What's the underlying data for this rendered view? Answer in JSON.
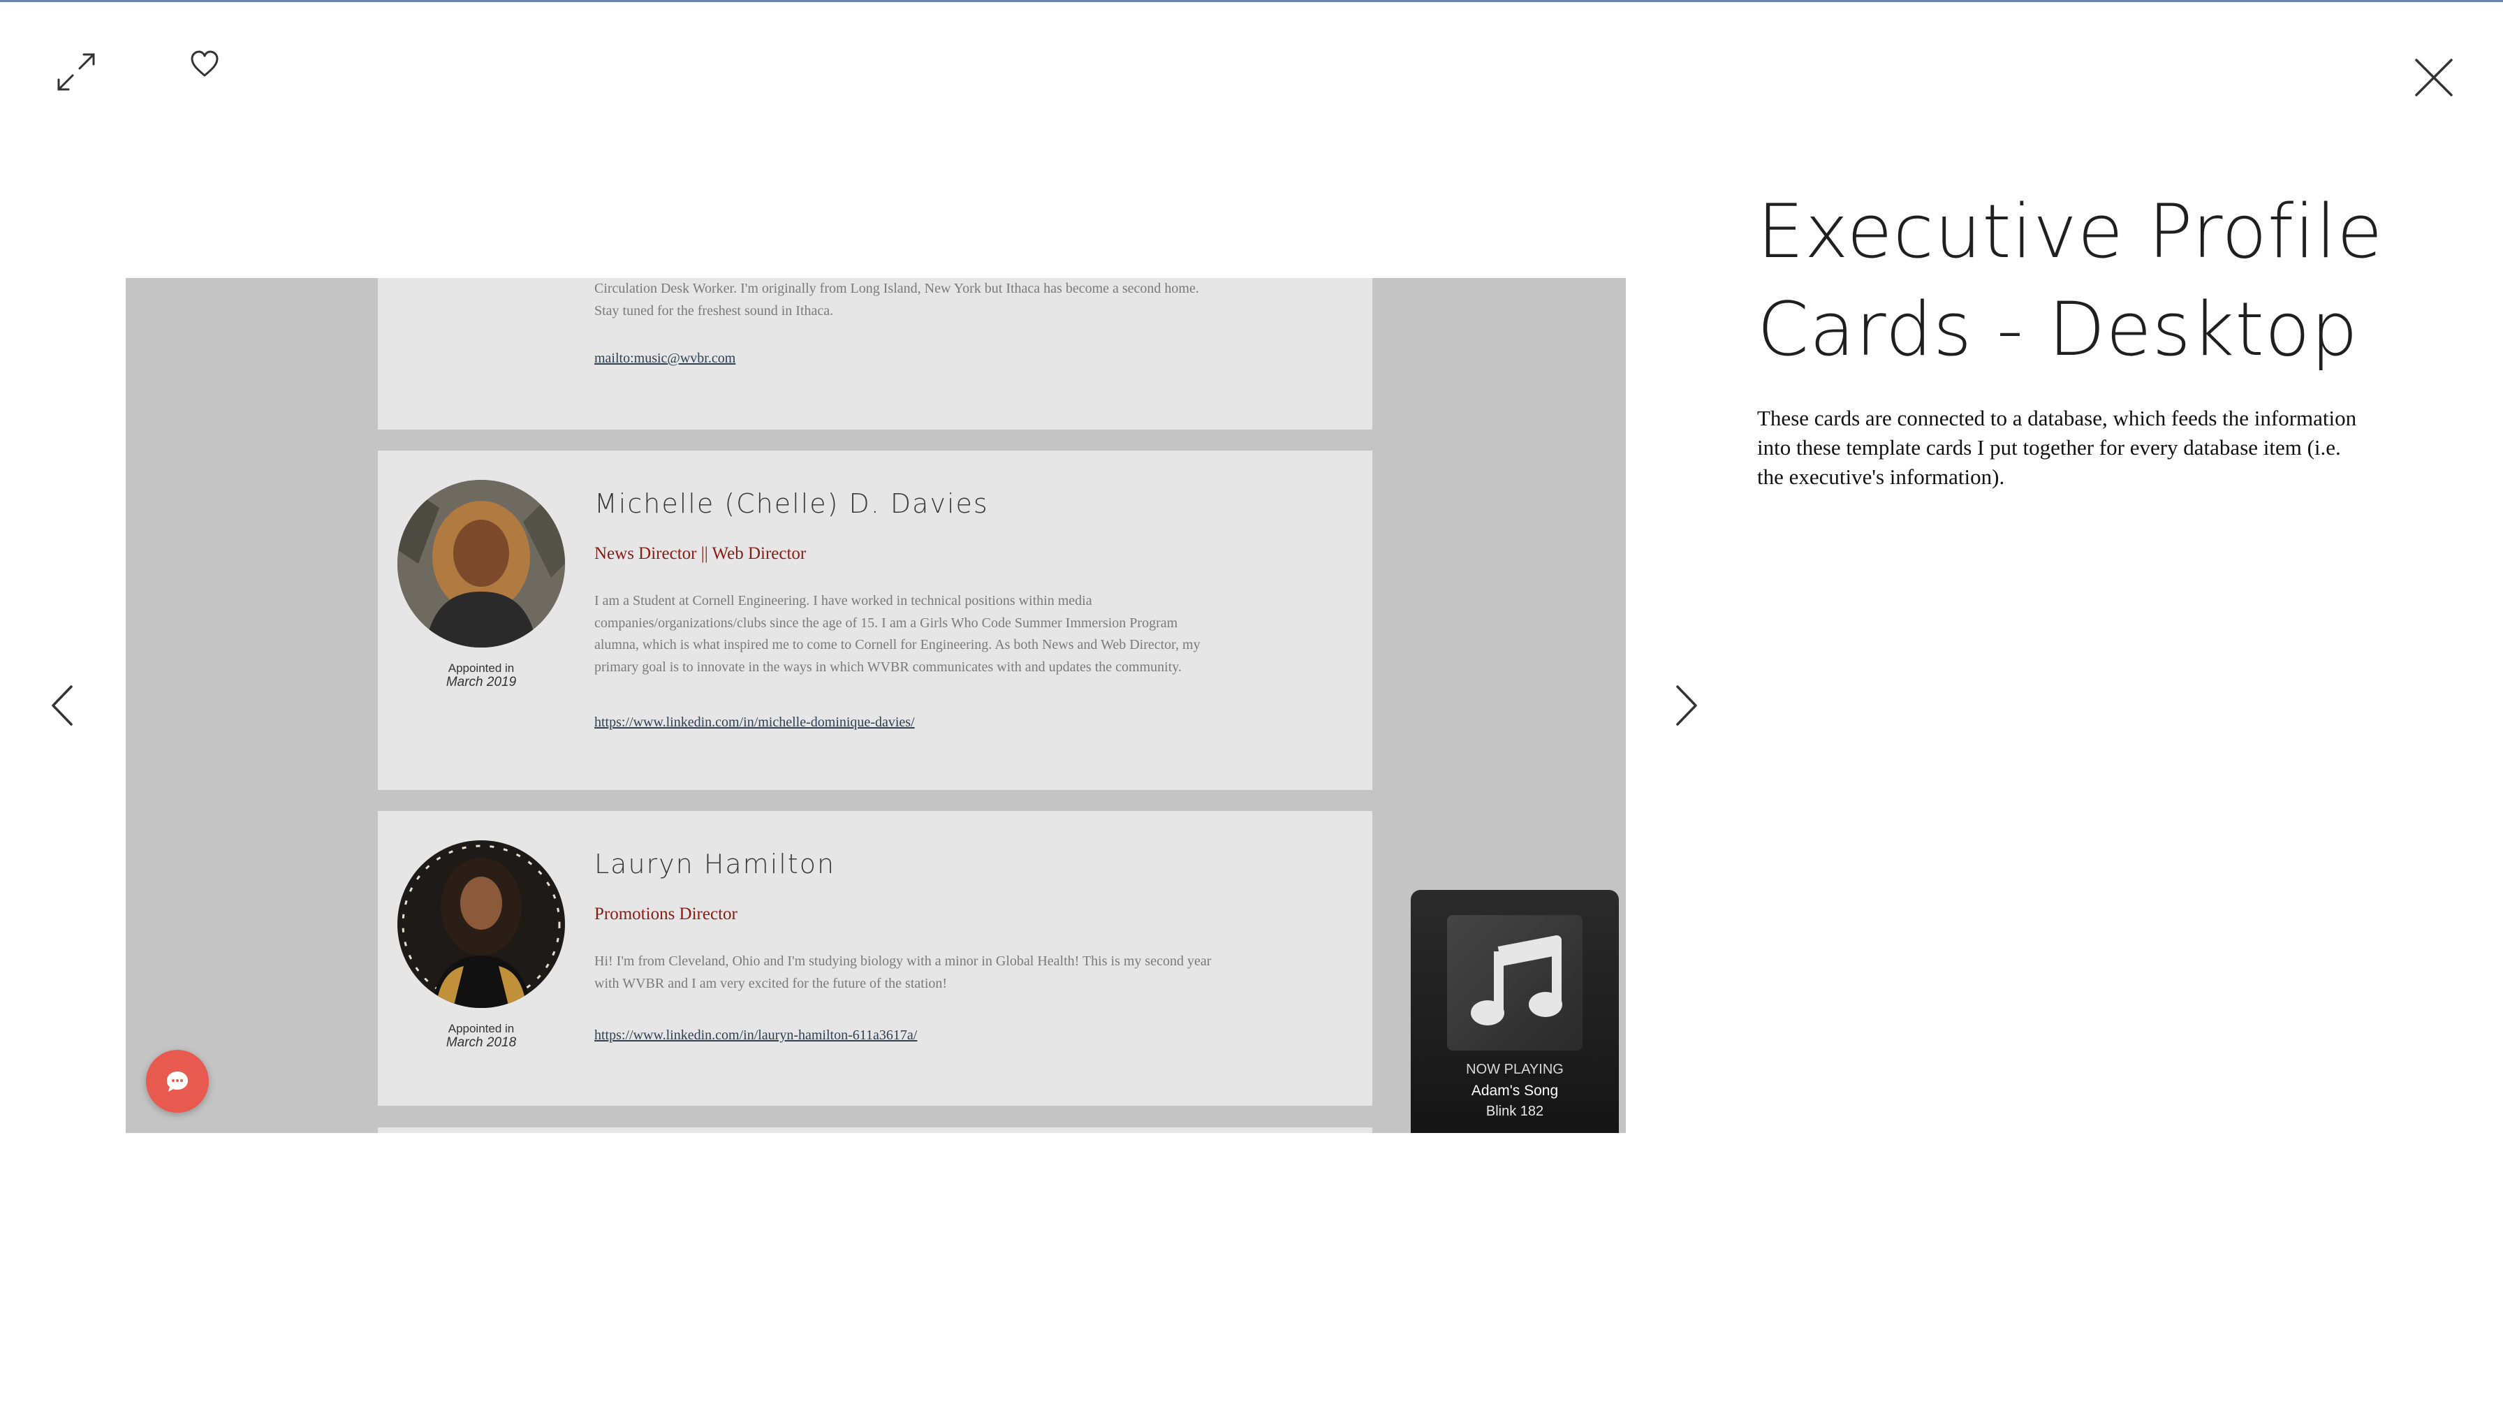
{
  "toolbar": {
    "expand_icon": "expand-arrows-icon",
    "like_icon": "heart-icon",
    "close_icon": "close-x-icon"
  },
  "navigation": {
    "prev_icon": "chevron-left-icon",
    "next_icon": "chevron-right-icon"
  },
  "project": {
    "title_line1": "Executive Profile",
    "title_line2": "Cards - Desktop",
    "description": "These cards are connected to a database, which feeds the information into these template cards I put together for every database item (i.e. the executive's information)."
  },
  "screenshot": {
    "partial_card": {
      "bio_line1": "Circulation Desk Worker. I'm originally from Long Island, New York but Ithaca has become a second home.",
      "bio_line2": "Stay tuned for the freshest sound in Ithaca.",
      "link": "mailto:music@wvbr.com"
    },
    "cards": [
      {
        "name": "Michelle (Chelle) D. Davies",
        "role": "News Director || Web Director",
        "bio": [
          "I am a Student at Cornell Engineering. I have worked in technical positions within media",
          "companies/organizations/clubs since the age of 15. I am a Girls Who Code Summer Immersion Program",
          "alumna, which is what inspired me to come to Cornell for Engineering. As both News and Web Director, my",
          "primary goal is to innovate in the ways in which WVBR communicates with and updates the community."
        ],
        "link": "https://www.linkedin.com/in/michelle-dominique-davies/",
        "appointed_label": "Appointed in",
        "appointed_date": "March 2019"
      },
      {
        "name": "Lauryn Hamilton",
        "role": "Promotions Director",
        "bio": [
          "Hi! I'm from Cleveland, Ohio and I'm studying biology with a minor in Global Health! This is my second year",
          "with WVBR and I am very excited for the future of the station!"
        ],
        "link": "https://www.linkedin.com/in/lauryn-hamilton-611a3617a/",
        "appointed_label": "Appointed in",
        "appointed_date": "March 2018"
      }
    ],
    "chat_icon": "chat-bubble-icon",
    "player": {
      "art_icon": "music-note-icon",
      "status": "NOW PLAYING",
      "song": "Adam's Song",
      "artist": "Blink 182"
    }
  },
  "colors": {
    "accent_role": "#8b1a12",
    "link": "#2e3f50",
    "chat_button": "#e85a50",
    "viewport_bg": "#c4c4c4",
    "card_bg": "#e6e6e6"
  }
}
